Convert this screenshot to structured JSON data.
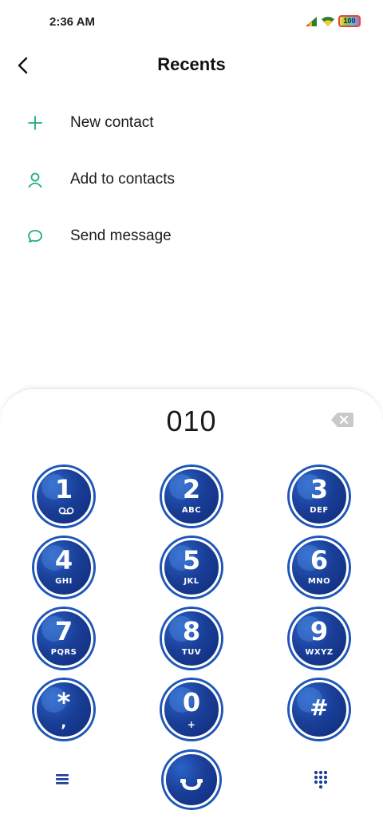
{
  "status": {
    "time": "2:36 AM",
    "battery": "100"
  },
  "header": {
    "title": "Recents"
  },
  "menu": [
    {
      "label": "New contact",
      "icon": "plus-icon"
    },
    {
      "label": "Add to contacts",
      "icon": "person-icon"
    },
    {
      "label": "Send message",
      "icon": "chat-bubble-icon"
    }
  ],
  "dialer": {
    "number": "010",
    "keys": [
      {
        "digit": "1",
        "letters": ""
      },
      {
        "digit": "2",
        "letters": "ABC"
      },
      {
        "digit": "3",
        "letters": "DEF"
      },
      {
        "digit": "4",
        "letters": "GHI"
      },
      {
        "digit": "5",
        "letters": "JKL"
      },
      {
        "digit": "6",
        "letters": "MNO"
      },
      {
        "digit": "7",
        "letters": "PQRS"
      },
      {
        "digit": "8",
        "letters": "TUV"
      },
      {
        "digit": "9",
        "letters": "WXYZ"
      },
      {
        "digit": "*",
        "letters": ","
      },
      {
        "digit": "0",
        "letters": "+"
      },
      {
        "digit": "#",
        "letters": ""
      }
    ]
  },
  "colors": {
    "accent": "#1fae7a",
    "key_blue": "#1a3f98",
    "key_ring": "#1f56b8"
  }
}
